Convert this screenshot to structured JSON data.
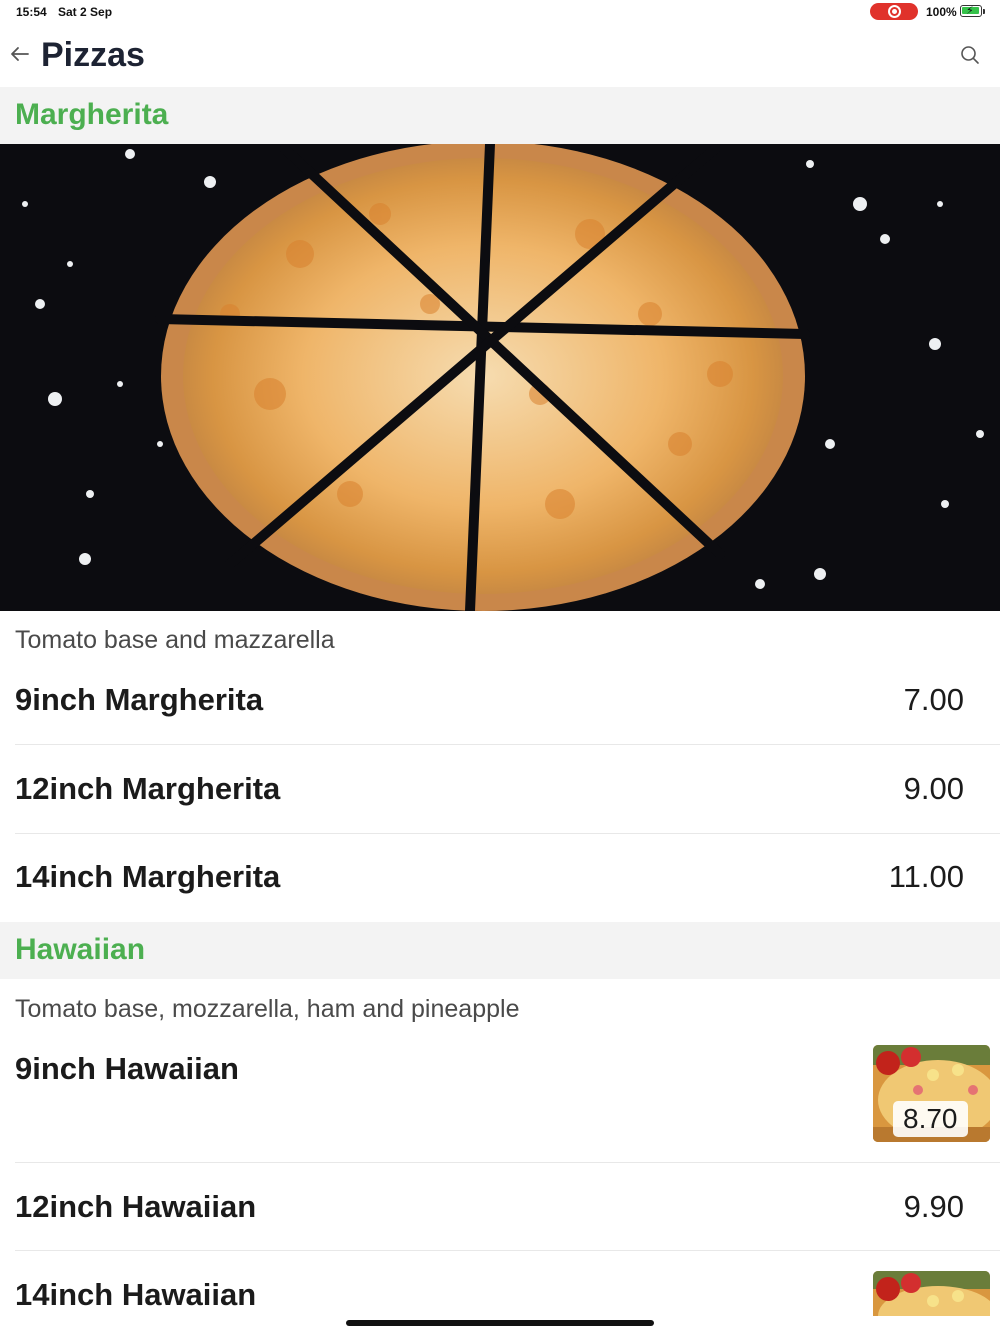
{
  "status": {
    "time": "15:54",
    "date": "Sat 2 Sep",
    "battery": "100%"
  },
  "header": {
    "title": "Pizzas",
    "back_icon": "arrow-left-icon",
    "search_icon": "search-icon"
  },
  "colors": {
    "accent": "#4caf50",
    "section_bg": "#f3f3f3",
    "record": "#e0322b"
  },
  "sections": [
    {
      "title": "Margherita",
      "description": "Tomato base and mazzarella",
      "items": [
        {
          "name": "9inch Margherita",
          "price": "7.00"
        },
        {
          "name": "12inch Margherita",
          "price": "9.00"
        },
        {
          "name": "14inch Margherita",
          "price": "11.00"
        }
      ]
    },
    {
      "title": "Hawaiian",
      "description": "Tomato base, mozzarella, ham and pineapple",
      "items": [
        {
          "name": "9inch Hawaiian",
          "price": "8.70"
        },
        {
          "name": "12inch Hawaiian",
          "price": "9.90"
        },
        {
          "name": "14inch Hawaiian",
          "price": ""
        }
      ]
    }
  ]
}
